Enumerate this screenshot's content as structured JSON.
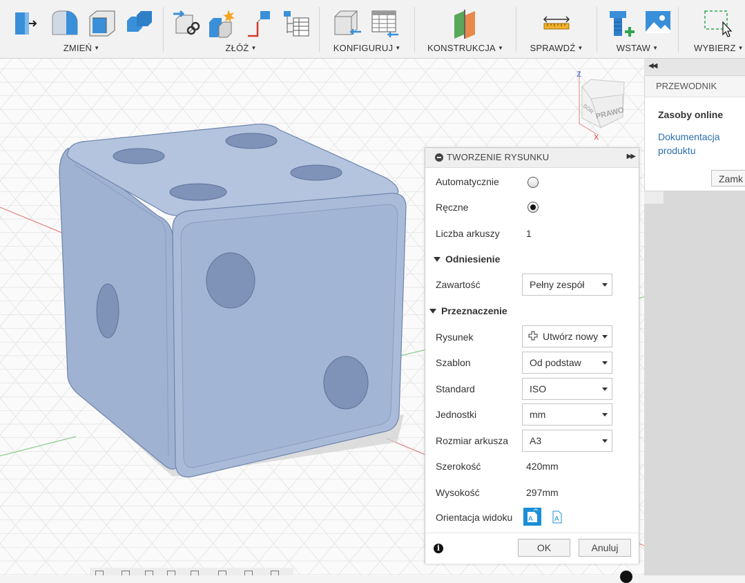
{
  "toolbar": {
    "groups": [
      {
        "label": "ZMIEŃ",
        "icons": [
          "press-pull-icon",
          "fillet-icon",
          "shell-icon",
          "combine-icon"
        ]
      },
      {
        "label": "ZŁÓŻ",
        "icons": [
          "joint-icon",
          "as-built-joint-icon",
          "joint-origin-icon",
          "bill-of-materials-icon"
        ]
      },
      {
        "label": "KONFIGURUJ",
        "icons": [
          "configure-body-icon",
          "configuration-table-icon"
        ]
      },
      {
        "label": "KONSTRUKCJA",
        "icons": [
          "construction-plane-icon"
        ]
      },
      {
        "label": "SPRAWDŹ",
        "icons": [
          "measure-icon"
        ]
      },
      {
        "label": "WSTAW",
        "icons": [
          "insert-mesh-icon",
          "insert-image-icon"
        ]
      },
      {
        "label": "WYBIERZ",
        "icons": [
          "select-icon"
        ]
      }
    ]
  },
  "viewcube": {
    "face_label": "PRAWO",
    "side_label": "SOR",
    "axis_z": "Z",
    "axis_x": "X"
  },
  "guide": {
    "header": "PRZEWODNIK",
    "title": "Zasoby online",
    "link": "Dokumentacja produktu",
    "close_label": "Zamk"
  },
  "dialog": {
    "title": "TWORZENIE RYSUNKU",
    "auto_label": "Automatycznie",
    "manual_label": "Ręczne",
    "manual_selected": true,
    "sheets_label": "Liczba arkuszy",
    "sheets_value": "1",
    "reference_section": "Odniesienie",
    "contents_label": "Zawartość",
    "contents_value": "Pełny zespół",
    "destination_section": "Przeznaczenie",
    "drawing_label": "Rysunek",
    "drawing_value": "Utwórz nowy",
    "template_label": "Szablon",
    "template_value": "Od podstaw",
    "standard_label": "Standard",
    "standard_value": "ISO",
    "units_label": "Jednostki",
    "units_value": "mm",
    "sheet_size_label": "Rozmiar arkusza",
    "sheet_size_value": "A3",
    "width_label": "Szerokość",
    "width_value": "420mm",
    "height_label": "Wysokość",
    "height_value": "297mm",
    "orientation_label": "Orientacja widoku",
    "ok_label": "OK",
    "cancel_label": "Anuluj"
  },
  "colors": {
    "accent": "#1b8fd6",
    "dice_body": "#a9bbd8",
    "grid_red": "#e57f7f",
    "grid_green": "#86cf86"
  }
}
